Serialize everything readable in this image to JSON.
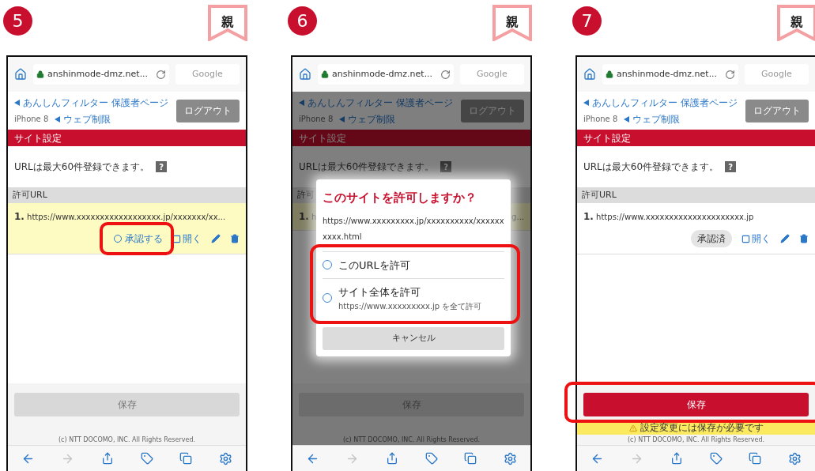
{
  "steps": [
    {
      "number": "5",
      "tag": "親",
      "browser": {
        "address": "anshinmode-dmz.net...",
        "search": "Google"
      },
      "nav": {
        "parent_link": "あんしんフィルター 保護者ページ",
        "device": "iPhone 8",
        "section_link": "ウェブ制限",
        "logout": "ログアウト"
      },
      "section_title": "サイト設定",
      "info": "URLは最大60件登録できます。",
      "help": "?",
      "list_label": "許可URL",
      "rows": [
        {
          "kind": "pending",
          "number": "1.",
          "url": "https://www.xxxxxxxxxxxxxxxxxx.jp/xxxxxxx/xx...",
          "status": "承認する",
          "open": "開く",
          "highlighted": true
        }
      ],
      "save": {
        "label": "保存",
        "disabled": true,
        "highlighted": false
      },
      "copyright": "(c) NTT DOCOMO, INC. All Rights Reserved.",
      "toolbar": {
        "forward_disabled": true
      }
    },
    {
      "number": "6",
      "tag": "親",
      "browser": {
        "address": "anshinmode-dmz.net...",
        "search": "Google"
      },
      "nav": {
        "parent_link": "あんしんフィルター 保護者ページ",
        "device": "iPhone 8",
        "section_link": "ウェブ制限",
        "logout": "ログアウト"
      },
      "section_title": "サイト設定",
      "info": "URLは最大60件登録できます。",
      "help": "?",
      "list_label": "許可",
      "rows": [
        {
          "kind": "pending",
          "number": "1.",
          "url": "h",
          "tail": "g..."
        }
      ],
      "save": {
        "label": "保存",
        "disabled": true,
        "highlighted": false
      },
      "copyright": "(c) NTT DOCOMO, INC. All Rights Reserved.",
      "toolbar": {
        "forward_disabled": true
      },
      "dialog": {
        "title": "このサイトを許可しますか？",
        "url": "https://www.xxxxxxxxx.jp/xxxxxxxxxx/xxxxxxxxxx.html",
        "options_highlighted": true,
        "options": [
          {
            "label": "このURLを許可",
            "selected": false
          },
          {
            "label": "サイト全体を許可",
            "sub": "https://www.xxxxxxxxx.jp を全て許可",
            "selected": false
          }
        ],
        "cancel": "キャンセル"
      }
    },
    {
      "number": "7",
      "tag": "親",
      "browser": {
        "address": "anshinmode-dmz.net...",
        "search": "Google"
      },
      "nav": {
        "parent_link": "あんしんフィルター 保護者ページ",
        "device": "iPhone 8",
        "section_link": "ウェブ制限",
        "logout": "ログアウト"
      },
      "section_title": "サイト設定",
      "info": "URLは最大60件登録できます。",
      "help": "?",
      "list_label": "許可URL",
      "rows": [
        {
          "kind": "approved",
          "number": "1.",
          "url": "https://www.xxxxxxxxxxxxxxxxxxxxx.jp",
          "status": "承認済",
          "open": "開く",
          "highlighted": false
        }
      ],
      "save": {
        "label": "保存",
        "disabled": false,
        "highlighted": true
      },
      "warning": "設定変更には保存が必要です",
      "copyright": "(c) NTT DOCOMO, INC. All Rights Reserved.",
      "toolbar": {
        "forward_disabled": true
      }
    }
  ]
}
